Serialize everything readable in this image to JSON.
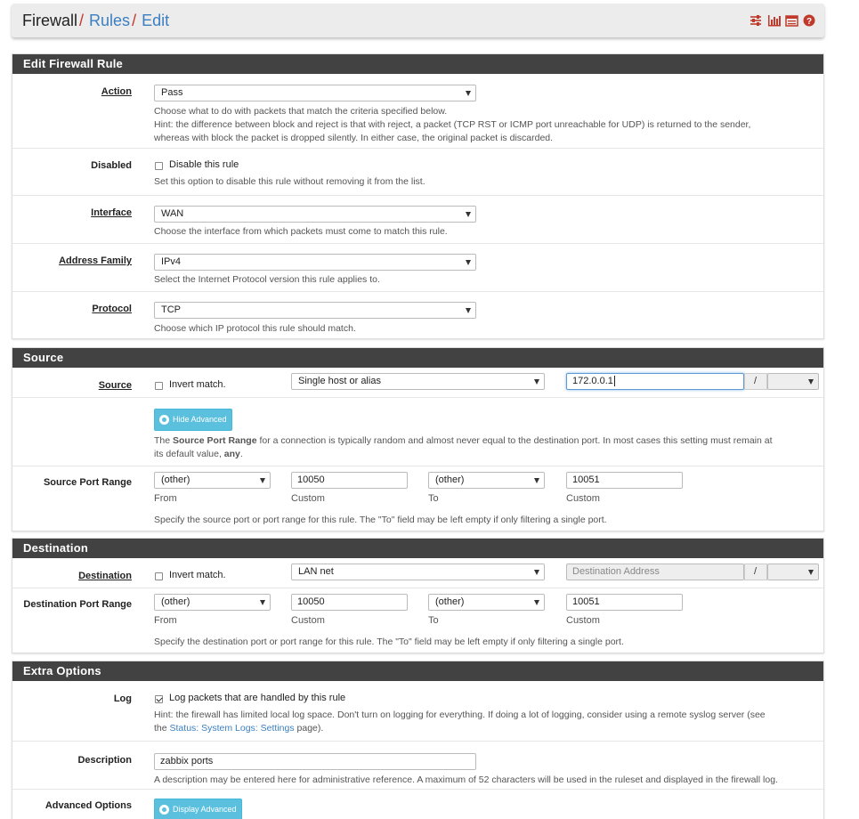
{
  "breadcrumb": {
    "root": "Firewall",
    "sep1": "/",
    "rules": "Rules",
    "sep2": "/",
    "edit": "Edit"
  },
  "header_icons": [
    "sliders-icon",
    "bar-chart-icon",
    "list-icon",
    "help-icon"
  ],
  "accent_color": "#c0392b",
  "link_color": "#3c7fc1",
  "edit_panel": {
    "heading": "Edit Firewall Rule",
    "action": {
      "label": "Action",
      "value": "Pass",
      "help1": "Choose what to do with packets that match the criteria specified below.",
      "help2": "Hint: the difference between block and reject is that with reject, a packet (TCP RST or ICMP port unreachable for UDP) is returned to the sender,",
      "help3": "whereas with block the packet is dropped silently. In either case, the original packet is discarded."
    },
    "disabled": {
      "label": "Disabled",
      "checkbox": "Disable this rule",
      "help": "Set this option to disable this rule without removing it from the list."
    },
    "interface": {
      "label": "Interface",
      "value": "WAN",
      "help": "Choose the interface from which packets must come to match this rule."
    },
    "family": {
      "label": "Address Family",
      "value": "IPv4",
      "help": "Select the Internet Protocol version this rule applies to."
    },
    "protocol": {
      "label": "Protocol",
      "value": "TCP",
      "help": "Choose which IP protocol this rule should match."
    }
  },
  "source_panel": {
    "heading": "Source",
    "source": {
      "label": "Source",
      "invert": "Invert match.",
      "type": "Single host or alias",
      "address": "172.0.0.1",
      "slash": "/",
      "mask": ""
    },
    "hide_advanced": "Hide Advanced",
    "adv_help_pre": "The ",
    "adv_help_bold": "Source Port Range",
    "adv_help_mid": " for a connection is typically random and almost never equal to the destination port. In most cases this setting must remain at",
    "adv_help_line2_pre": "its default value, ",
    "adv_help_any": "any",
    "adv_help_end": ".",
    "port_range": {
      "label": "Source Port Range",
      "from_select": "(other)",
      "from_custom": "10050",
      "to_select": "(other)",
      "to_custom": "10051",
      "from": "From",
      "custom1": "Custom",
      "to": "To",
      "custom2": "Custom",
      "help": "Specify the source port or port range for this rule. The \"To\" field may be left empty if only filtering a single port."
    }
  },
  "dest_panel": {
    "heading": "Destination",
    "destination": {
      "label": "Destination",
      "invert": "Invert match.",
      "type": "LAN net",
      "placeholder": "Destination Address",
      "slash": "/"
    },
    "port_range": {
      "label": "Destination Port Range",
      "from_select": "(other)",
      "from_custom": "10050",
      "to_select": "(other)",
      "to_custom": "10051",
      "from": "From",
      "custom1": "Custom",
      "to": "To",
      "custom2": "Custom",
      "help": "Specify the destination port or port range for this rule. The \"To\" field may be left empty if only filtering a single port."
    }
  },
  "extra_panel": {
    "heading": "Extra Options",
    "log": {
      "label": "Log",
      "checkbox": "Log packets that are handled by this rule",
      "help1": "Hint: the firewall has limited local log space. Don't turn on logging for everything. If doing a lot of logging, consider using a remote syslog server (see",
      "help2_pre": "the ",
      "help2_link": "Status: System Logs: Settings",
      "help2_post": " page)."
    },
    "description": {
      "label": "Description",
      "value": "zabbix ports",
      "help": "A description may be entered here for administrative reference. A maximum of 52 characters will be used in the ruleset and displayed in the firewall log."
    },
    "advanced": {
      "label": "Advanced Options",
      "button": "Display Advanced"
    }
  }
}
